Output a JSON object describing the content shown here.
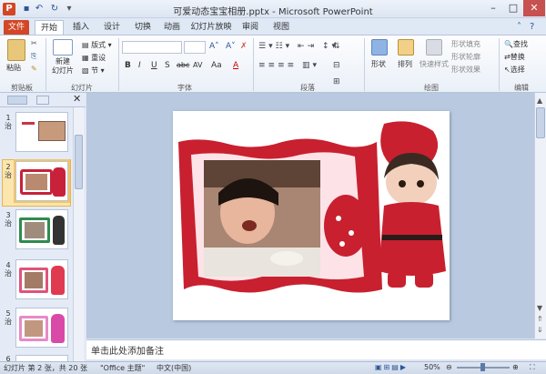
{
  "window": {
    "title": "可爱动态宝宝相册.pptx - Microsoft PowerPoint",
    "minimize": "–",
    "maximize": "□",
    "close": "✕"
  },
  "tabs": [
    "文件",
    "开始",
    "插入",
    "设计",
    "切换",
    "动画",
    "幻灯片放映",
    "审阅",
    "视图"
  ],
  "ribbon": {
    "clipboard": {
      "paste": "粘贴",
      "label": "剪贴板"
    },
    "slides": {
      "new_slide": "新建\n幻灯片",
      "layout": "版式",
      "reset": "重设",
      "section": "节",
      "label": "幻灯片"
    },
    "font": {
      "label": "字体",
      "bold": "B",
      "italic": "I",
      "underline": "U",
      "strike": "S",
      "abc": "abc",
      "spacing": "AV",
      "case": "Aa",
      "color": "A"
    },
    "paragraph": {
      "label": "段落"
    },
    "drawing": {
      "shapes": "形状",
      "arrange": "排列",
      "quick_styles": "快速样式",
      "fill": "形状填充",
      "outline": "形状轮廓",
      "effects": "形状效果",
      "label": "绘图"
    },
    "editing": {
      "find": "查找",
      "replace": "替换",
      "select": "选择",
      "label": "编辑"
    }
  },
  "slides_pane": {
    "slides": [
      {
        "num": "1\n治"
      },
      {
        "num": "2\n治"
      },
      {
        "num": "3\n治"
      },
      {
        "num": "4\n治"
      },
      {
        "num": "5\n治"
      },
      {
        "num": "6\n治"
      }
    ]
  },
  "notes": {
    "placeholder": "单击此处添加备注"
  },
  "status": {
    "slide_info": "幻灯片 第 2 张，共 20 张",
    "theme": "\"Office 主题\"",
    "language": "中文(中国)",
    "zoom": "50%"
  },
  "colors": {
    "accent": "#d24726",
    "ribbon_blue": "#2b5797",
    "selected": "#fbe6b0"
  }
}
